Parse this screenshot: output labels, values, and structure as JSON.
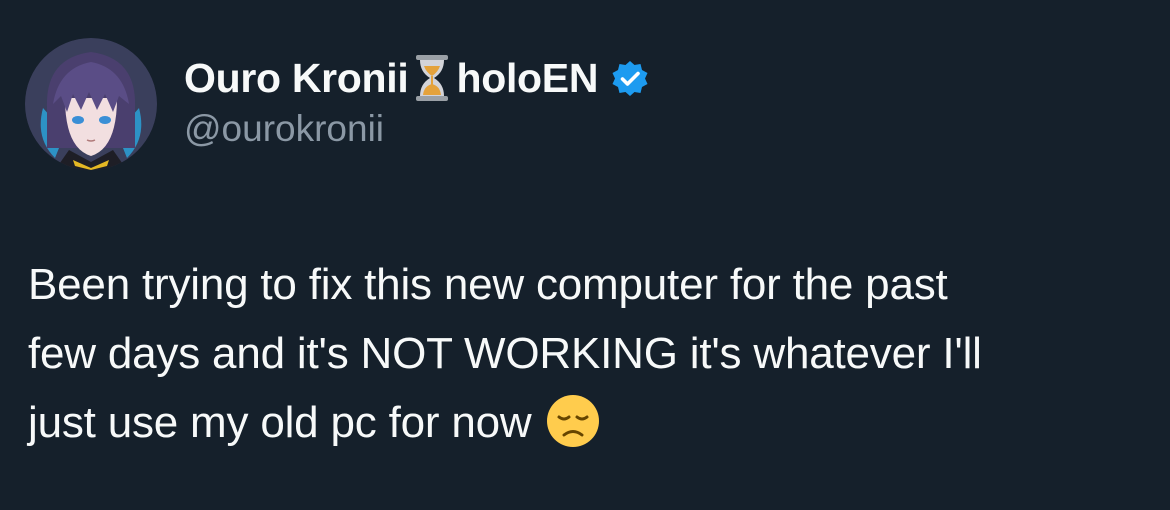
{
  "author": {
    "display_name": "Ouro Kronii",
    "name_suffix": "holoEN",
    "handle": "@ourokronii",
    "name_icon": "hourglass-icon",
    "badge_icon": "verified-badge-icon",
    "badge_color": "#1d9bf0"
  },
  "tweet": {
    "lines": [
      "Been trying to fix this new computer for the past",
      "few days and it's NOT WORKING it's whatever I'll",
      "just use my old pc for now"
    ],
    "trailing_emoji": "disappointed-face-emoji"
  },
  "theme": {
    "background": "#15202b",
    "text_color": "#f7f9f9",
    "secondary_text_color": "#8b98a5"
  }
}
